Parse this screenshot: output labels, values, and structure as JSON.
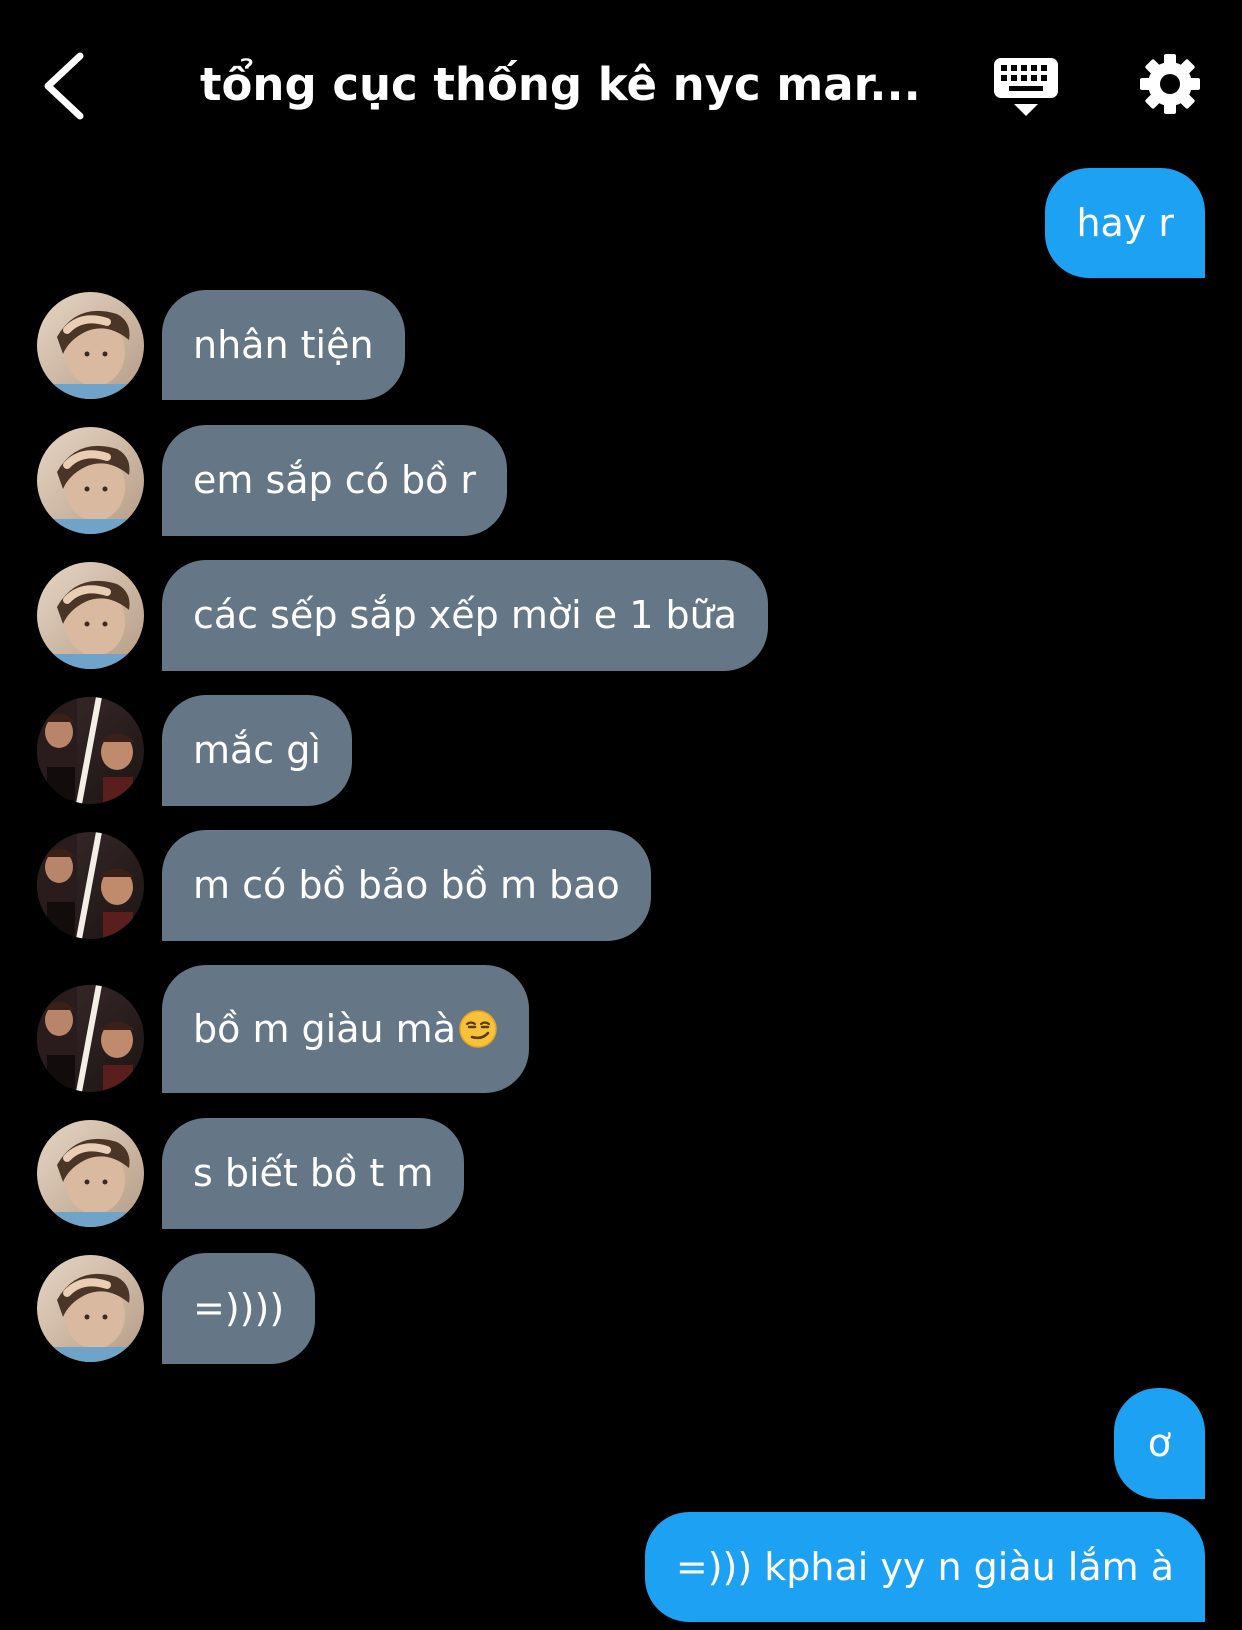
{
  "header": {
    "title": "tổng cục thống kê nyc mar...",
    "back_icon": "chevron-left-icon",
    "keyboard_icon": "keyboard-icon",
    "settings_icon": "gear-icon"
  },
  "colors": {
    "background": "#000000",
    "incoming_bubble": "#657786",
    "outgoing_bubble": "#1da1f2",
    "text": "#ffffff"
  },
  "messages": [
    {
      "side": "out",
      "text": "hay r"
    },
    {
      "side": "in",
      "avatar": "avatar-a",
      "text": "nhân tiện"
    },
    {
      "side": "in",
      "avatar": "avatar-a",
      "text": "em sắp có bồ r"
    },
    {
      "side": "in",
      "avatar": "avatar-a",
      "text": "các sếp sắp xếp mời e 1 bữa"
    },
    {
      "side": "in",
      "avatar": "avatar-b",
      "text": "mắc gì"
    },
    {
      "side": "in",
      "avatar": "avatar-b",
      "text": "m có bồ bảo bồ m bao"
    },
    {
      "side": "in",
      "avatar": "avatar-b",
      "text": "bồ m giàu mà",
      "emoji": "smirk-emoji"
    },
    {
      "side": "in",
      "avatar": "avatar-a",
      "text": "s biết bồ t m"
    },
    {
      "side": "in",
      "avatar": "avatar-a",
      "text": "=))))"
    },
    {
      "side": "out",
      "text": "ơ"
    },
    {
      "side": "out",
      "text": "=))) kphai yy n giàu lắm à"
    }
  ]
}
